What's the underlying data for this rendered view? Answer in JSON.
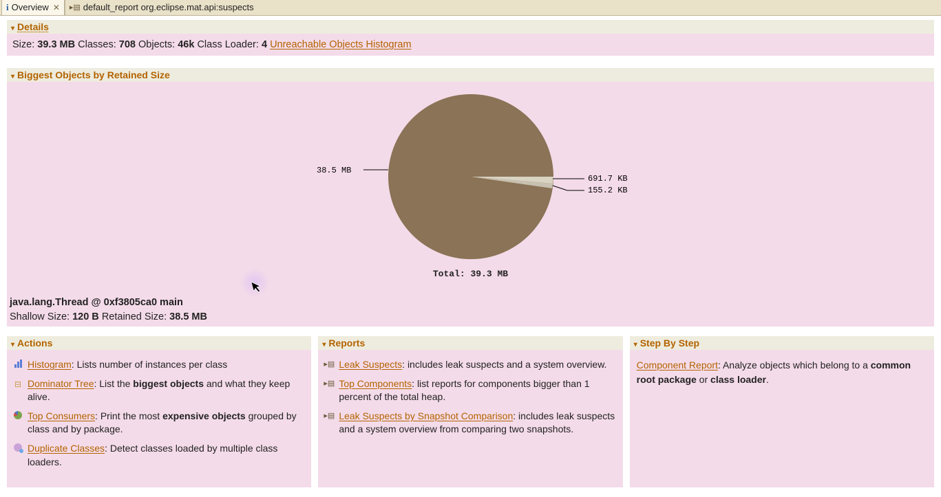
{
  "tabs": {
    "overview": "Overview",
    "report": "default_report  org.eclipse.mat.api:suspects"
  },
  "details": {
    "header": "Details",
    "size_label": "Size:",
    "size_value": "39.3 MB",
    "classes_label": "Classes:",
    "classes_value": "708",
    "objects_label": "Objects:",
    "objects_value": "46k",
    "classloader_label": "Class Loader:",
    "classloader_value": "4",
    "unreachable_link": "Unreachable Objects Histogram"
  },
  "biggest": {
    "header": "Biggest Objects by Retained Size",
    "total_label": "Total:",
    "total_value": "39.3 MB",
    "label_main": "38.5 MB",
    "label_a": "691.7 KB",
    "label_b": "155.2 KB",
    "selected_object": "java.lang.Thread @ 0xf3805ca0 main",
    "shallow_label": "Shallow Size:",
    "shallow_value": "120 B",
    "retained_label": "Retained Size:",
    "retained_value": "38.5 MB"
  },
  "actions": {
    "header": "Actions",
    "histogram_link": "Histogram",
    "histogram_desc": ": Lists number of instances per class",
    "dominator_link": "Dominator Tree",
    "dominator_desc_a": ": List the ",
    "dominator_desc_bold": "biggest objects",
    "dominator_desc_b": " and what they keep alive.",
    "topconsumers_link": "Top Consumers",
    "topconsumers_desc_a": ": Print the most ",
    "topconsumers_desc_bold": "expensive objects",
    "topconsumers_desc_b": " grouped by class and by package.",
    "duplicate_link": "Duplicate Classes",
    "duplicate_desc": ": Detect classes loaded by multiple class loaders."
  },
  "reports": {
    "header": "Reports",
    "leak_link": "Leak Suspects",
    "leak_desc": ": includes leak suspects and a system overview.",
    "topcomp_link": "Top Components",
    "topcomp_desc": ": list reports for components bigger than 1 percent of the total heap.",
    "leakcmp_link": "Leak Suspects by Snapshot Comparison",
    "leakcmp_desc": ": includes leak suspects and a system overview from comparing two snapshots."
  },
  "step": {
    "header": "Step By Step",
    "comp_link": "Component Report",
    "comp_desc_a": ": Analyze objects which belong to a ",
    "comp_desc_b1": "common root package",
    "comp_desc_mid": " or ",
    "comp_desc_b2": "class loader",
    "comp_desc_end": "."
  },
  "chart_data": {
    "type": "pie",
    "title": "Biggest Objects by Retained Size",
    "total_label": "Total: 39.3 MB",
    "slices": [
      {
        "label": "38.5 MB",
        "value_mb": 38.5,
        "fraction": 0.979,
        "color": "#8a7356"
      },
      {
        "label": "691.7 KB",
        "value_mb": 0.6755,
        "fraction": 0.017,
        "color": "#d9d3c2"
      },
      {
        "label": "155.2 KB",
        "value_mb": 0.1516,
        "fraction": 0.004,
        "color": "#c8c0b0"
      }
    ]
  }
}
